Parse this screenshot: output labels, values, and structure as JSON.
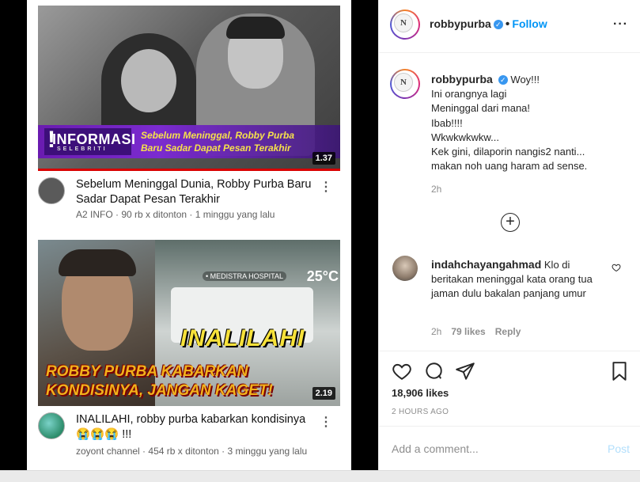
{
  "media": {
    "video1": {
      "banner_brand": "INFORMASI",
      "banner_brand_sub": "SELEBRITI",
      "banner_line1": "Sebelum Meninggal, Robby Purba",
      "banner_line2": "Baru Sadar Dapat Pesan Terakhir",
      "duration": "1.37",
      "title": "Sebelum Meninggal Dunia, Robby Purba Baru Sadar Dapat Pesan Terakhir",
      "meta": "A2 INFO · 90 rb x ditonton · 1 minggu yang lalu"
    },
    "video2": {
      "hospital_label": "• MEDISTRA HOSPITAL",
      "temperature": "25°C",
      "overlay_big": "INALILAHI",
      "overlay_line1": "ROBBY PURBA KABARKAN",
      "overlay_line2": "KONDISINYA, JANGAN KAGET!",
      "duration": "2.19",
      "title": "INALILAHI, robby purba kabarkan kondisinya 😭😭😭 !!!",
      "meta": "zoyont channel · 454 rb x ditonton · 3 minggu yang lalu"
    }
  },
  "header": {
    "username": "robbypurba",
    "follow_label": "Follow",
    "more_label": "···"
  },
  "caption": {
    "username": "robbypurba",
    "lines": [
      "Woy!!!",
      "Ini orangnya lagi",
      "Meninggal dari mana!",
      "Ibab!!!!",
      "Wkwkwkwkw...",
      "Kek gini, dilaporin nangis2 nanti...",
      "makan noh uang haram ad sense."
    ],
    "time": "2h"
  },
  "comment": {
    "username": "indahchayangahmad",
    "text": "Klo di beritakan meninggal kata orang tua jaman dulu bakalan panjang umur",
    "time": "2h",
    "likes": "79 likes",
    "reply_label": "Reply"
  },
  "post": {
    "likes": "18,906 likes",
    "time": "2 HOURS AGO"
  },
  "add_comment": {
    "placeholder": "Add a comment...",
    "post_label": "Post"
  },
  "colors": {
    "accent_blue": "#0095f6",
    "verified_blue": "#3897f0",
    "post_disabled": "#b2dffc"
  }
}
